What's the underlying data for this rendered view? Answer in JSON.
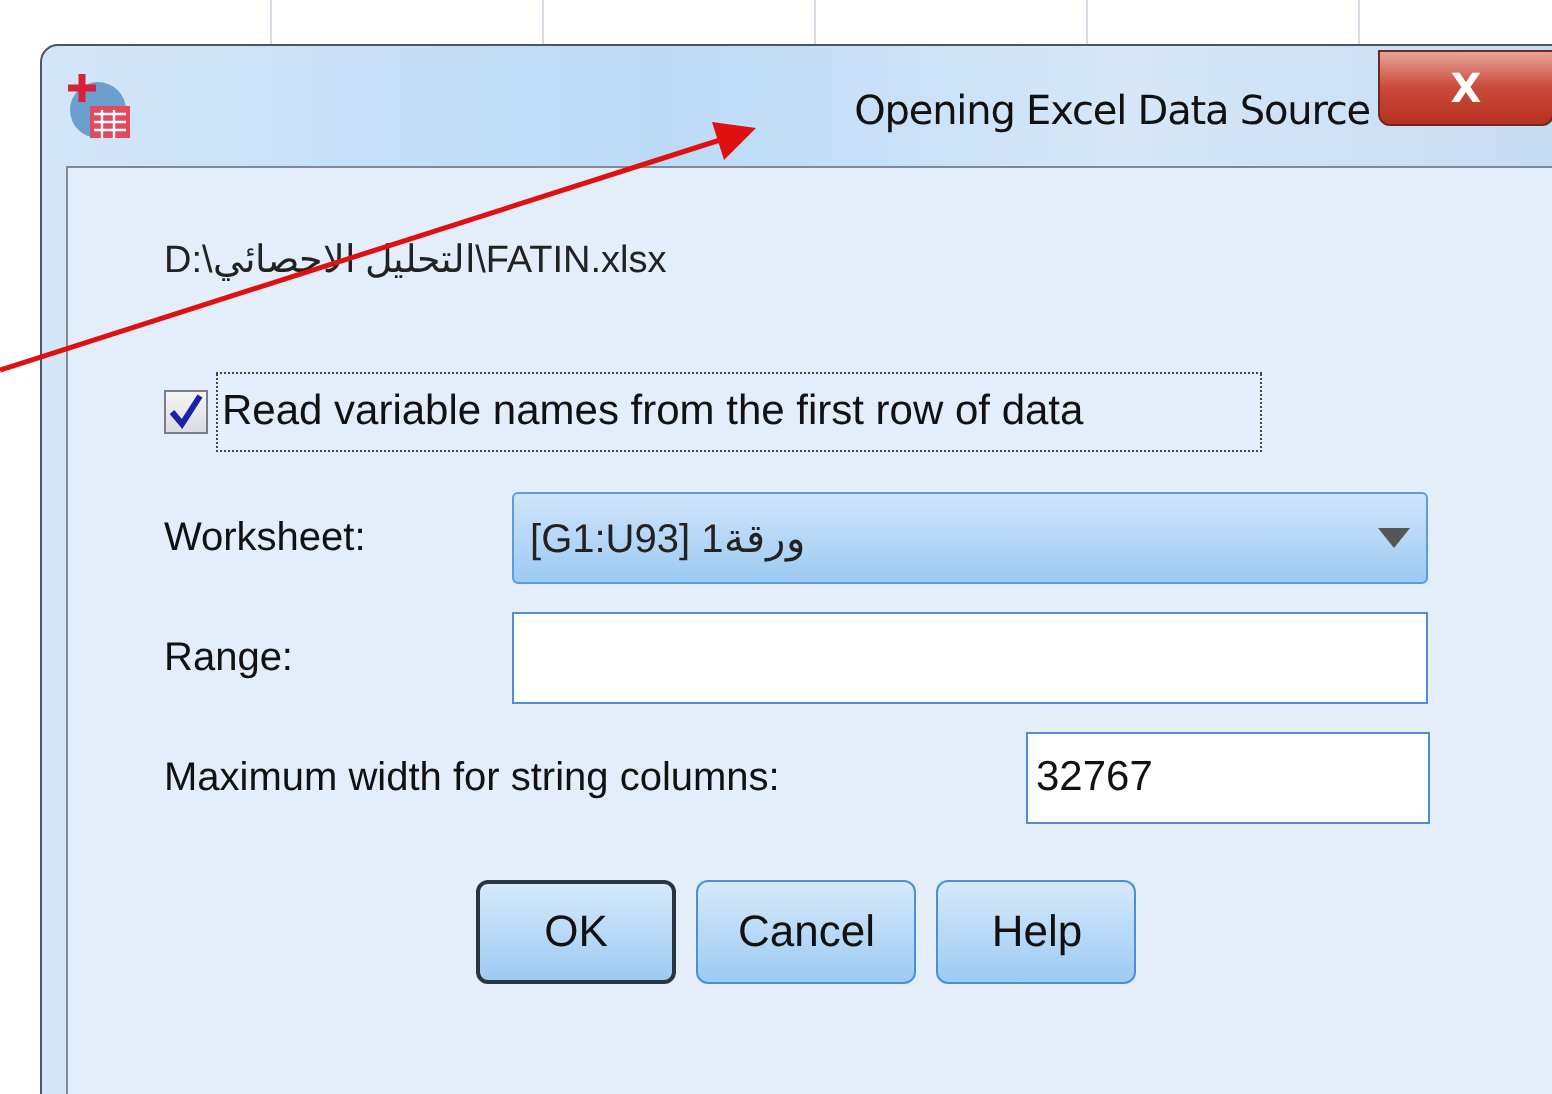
{
  "window": {
    "title": "Opening Excel Data Source",
    "close_label": "X"
  },
  "file_path": "D:\\التحليل الاحصائي\\FATIN.xlsx",
  "read_names": {
    "label": "Read variable names from the first row of data",
    "checked": true
  },
  "worksheet": {
    "label": "Worksheet:",
    "value": "ورقة1 [G1:U93]"
  },
  "range": {
    "label": "Range:"
  },
  "max_width": {
    "label": "Maximum width for string columns:",
    "value": "32767"
  },
  "buttons": [
    {
      "label": "OK",
      "default": true
    },
    {
      "label": "Cancel",
      "default": false
    },
    {
      "label": "Help",
      "default": false
    }
  ]
}
